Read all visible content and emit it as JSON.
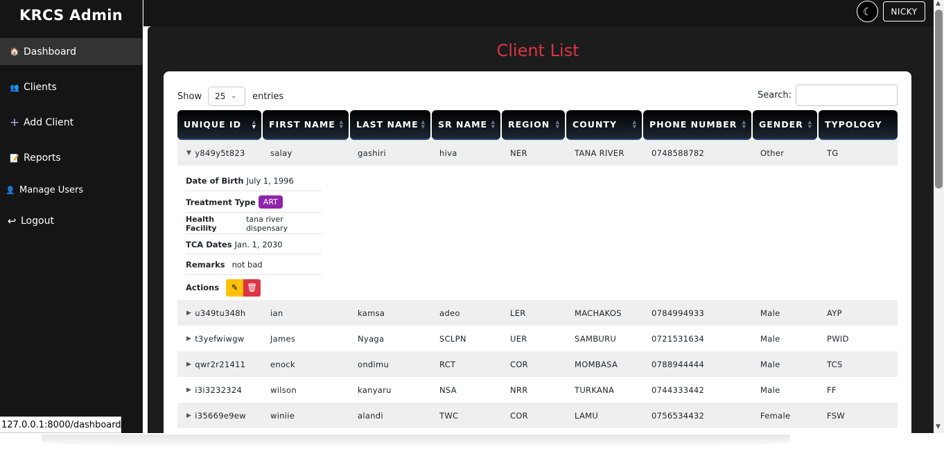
{
  "app": {
    "brand": "KRCS Admin",
    "user": "NICKY",
    "theme_icon": "moon-icon"
  },
  "sidebar": {
    "items": [
      {
        "label": "Dashboard",
        "icon": "house-icon",
        "glyph": "🏠"
      },
      {
        "label": "Clients",
        "icon": "users-icon",
        "glyph": "👥"
      },
      {
        "label": "Add Client",
        "icon": "plus-icon",
        "glyph": "+"
      },
      {
        "label": "Reports",
        "icon": "report-icon",
        "glyph": "📝"
      },
      {
        "label": "Manage Users",
        "icon": "user-icon",
        "glyph": "👤"
      },
      {
        "label": "Logout",
        "icon": "logout-icon",
        "glyph": "↩"
      }
    ]
  },
  "main": {
    "title": "Client List",
    "show_label": "Show",
    "entries_value": "25",
    "entries_label": "entries",
    "search_label": "Search:",
    "search_value": ""
  },
  "table": {
    "columns": [
      "UNIQUE ID",
      "FIRST NAME",
      "LAST NAME",
      "SR NAME",
      "REGION",
      "COUNTY",
      "PHONE NUMBER",
      "GENDER",
      "TYPOLOGY"
    ],
    "rows": [
      [
        "y849y5t823",
        "salay",
        "gashiri",
        "hiva",
        "NER",
        "TANA RIVER",
        "0748588782",
        "Other",
        "TG"
      ],
      [
        "u349tu348h",
        "ian",
        "kamsa",
        "adeo",
        "LER",
        "MACHAKOS",
        "0784994933",
        "Male",
        "AYP"
      ],
      [
        "t3yefwiwgw",
        "James",
        "Nyaga",
        "SCLPN",
        "UER",
        "SAMBURU",
        "0721531634",
        "Male",
        "PWID"
      ],
      [
        "qwr2r21411",
        "enock",
        "ondimu",
        "RCT",
        "COR",
        "MOMBASA",
        "0788944444",
        "Male",
        "TCS"
      ],
      [
        "i3i3232324",
        "wilson",
        "kanyaru",
        "NSA",
        "NRR",
        "TURKANA",
        "0744333442",
        "Male",
        "FF"
      ],
      [
        "i35669e9ew",
        "winiie",
        "alandi",
        "TWC",
        "COR",
        "LAMU",
        "0756534432",
        "Female",
        "FSW"
      ]
    ],
    "expanded": {
      "dob_label": "Date of Birth",
      "dob": "July 1, 1996",
      "treatment_label": "Treatment Type",
      "treatment": "ART",
      "facility_label": "Health Facility",
      "facility": "tana river dispensary",
      "tca_label": "TCA Dates",
      "tca": "Jan. 1, 2030",
      "remarks_label": "Remarks",
      "remarks": "not bad",
      "actions_label": "Actions"
    }
  },
  "statusbar": {
    "url": "127.0.0.1:8000/dashboard/"
  },
  "colors": {
    "accent": "#dc3545",
    "badge": "#8e24aa",
    "edit": "#ffc107",
    "sidebar": "#151515"
  }
}
